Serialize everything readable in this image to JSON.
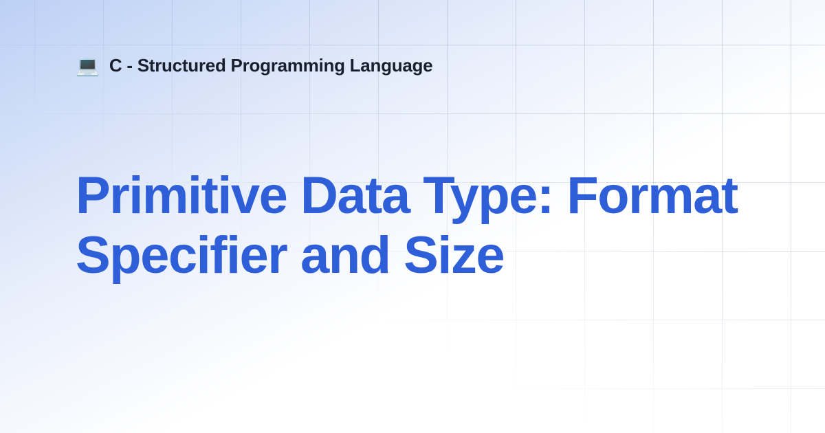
{
  "breadcrumb": {
    "icon": "💻",
    "text": "C - Structured Programming Language"
  },
  "title": "Primitive Data Type: Format Specifier and Size"
}
